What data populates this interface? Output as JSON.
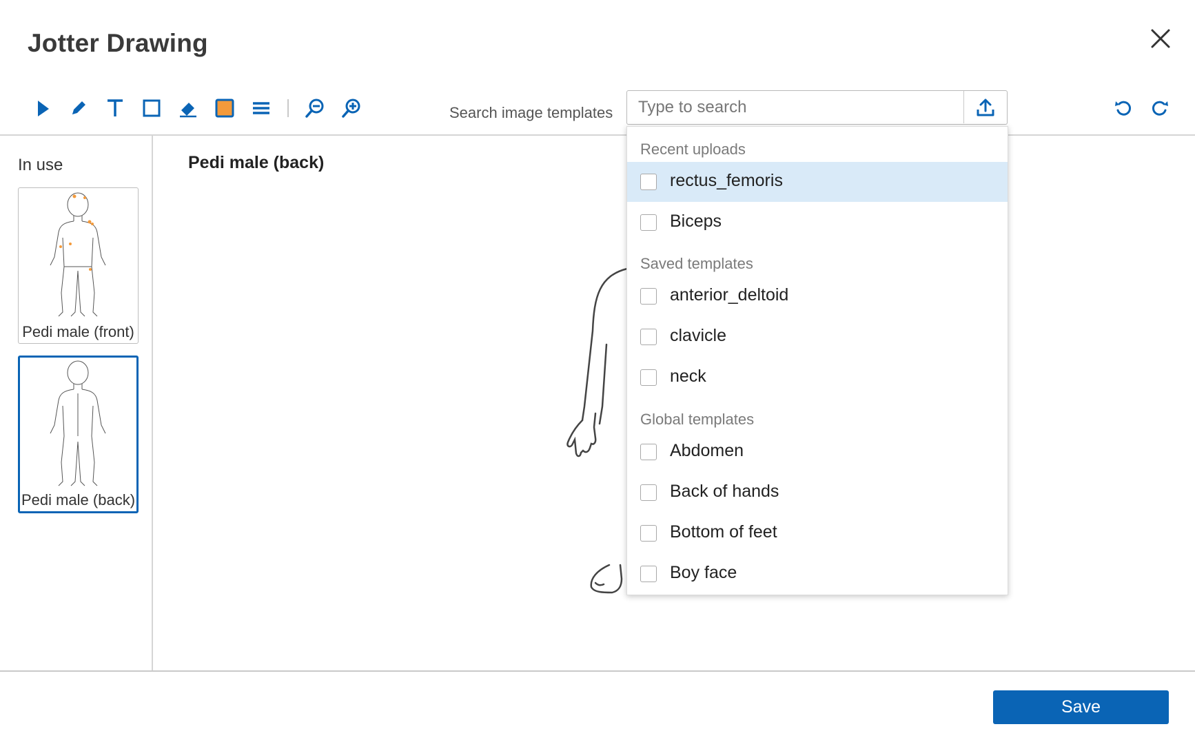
{
  "window": {
    "title": "Jotter Drawing",
    "close_icon": "close-icon"
  },
  "toolbar": {
    "tools": [
      {
        "name": "select-tool",
        "icon": "pointer-icon"
      },
      {
        "name": "pencil-tool",
        "icon": "pencil-icon"
      },
      {
        "name": "text-tool",
        "icon": "text-icon"
      },
      {
        "name": "rectangle-tool",
        "icon": "rectangle-icon"
      },
      {
        "name": "eraser-tool",
        "icon": "eraser-icon"
      },
      {
        "name": "color-picker",
        "icon": "color-swatch-icon",
        "color": "#f39a3b"
      },
      {
        "name": "line-weight-tool",
        "icon": "lines-icon"
      },
      {
        "name": "zoom-out",
        "icon": "zoom-out-icon"
      },
      {
        "name": "zoom-in",
        "icon": "zoom-in-icon"
      }
    ],
    "undo_icon": "undo-icon",
    "redo_icon": "redo-icon",
    "accent_color": "#0a64b5"
  },
  "search": {
    "label": "Search image templates",
    "placeholder": "Type to search",
    "value": "",
    "upload_icon": "upload-icon"
  },
  "sidebar": {
    "heading": "In use",
    "thumbnails": [
      {
        "label": "Pedi male (front)",
        "selected": false
      },
      {
        "label": "Pedi male (back)",
        "selected": true
      }
    ]
  },
  "canvas": {
    "title": "Pedi male (back)"
  },
  "dropdown": {
    "groups": [
      {
        "header": "Recent uploads",
        "options": [
          {
            "label": "rectus_femoris",
            "checked": false,
            "highlighted": true
          },
          {
            "label": "Biceps",
            "checked": false,
            "highlighted": false
          }
        ]
      },
      {
        "header": "Saved templates",
        "options": [
          {
            "label": "anterior_deltoid",
            "checked": false
          },
          {
            "label": "clavicle",
            "checked": false
          },
          {
            "label": "neck",
            "checked": false
          }
        ]
      },
      {
        "header": "Global templates",
        "options": [
          {
            "label": "Abdomen",
            "checked": false
          },
          {
            "label": "Back of hands",
            "checked": false
          },
          {
            "label": "Bottom of feet",
            "checked": false
          },
          {
            "label": "Boy face",
            "checked": false
          }
        ]
      }
    ]
  },
  "footer": {
    "save_label": "Save"
  }
}
